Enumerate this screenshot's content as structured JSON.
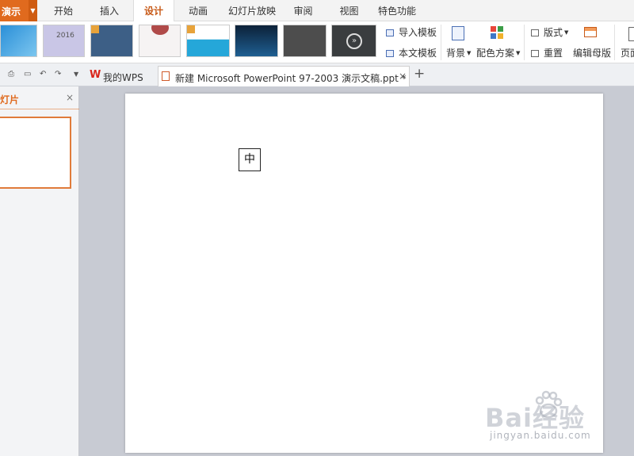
{
  "menubar": {
    "app_label": "演示",
    "tabs": [
      "开始",
      "插入",
      "设计",
      "动画",
      "幻灯片放映",
      "审阅",
      "视图",
      "特色功能"
    ],
    "active_tab": "设计"
  },
  "ribbon": {
    "thumb1_text": "2016",
    "import_template": "导入模板",
    "text_template": "本文模板",
    "background": "背景",
    "color_scheme": "配色方案",
    "layout": "版式",
    "reset": "重置",
    "edit_master": "编辑母版",
    "page_setup": "页面"
  },
  "tabstrip": {
    "wps_tab": "我的WPS",
    "doc_tab": "新建 Microsoft PowerPoint 97-2003 演示文稿.ppt *",
    "close_glyph": "×",
    "new_tab_glyph": "+"
  },
  "leftpanel": {
    "title": "灯片",
    "close_glyph": "×"
  },
  "slide": {
    "textbox_text": "中"
  },
  "watermark": {
    "brand": "Bai经验",
    "url": "jingyan.baidu.com"
  },
  "colors": {
    "accent": "#e06a1e",
    "active_tab_text": "#c85a18",
    "canvas_bg": "#c8cbd3"
  }
}
